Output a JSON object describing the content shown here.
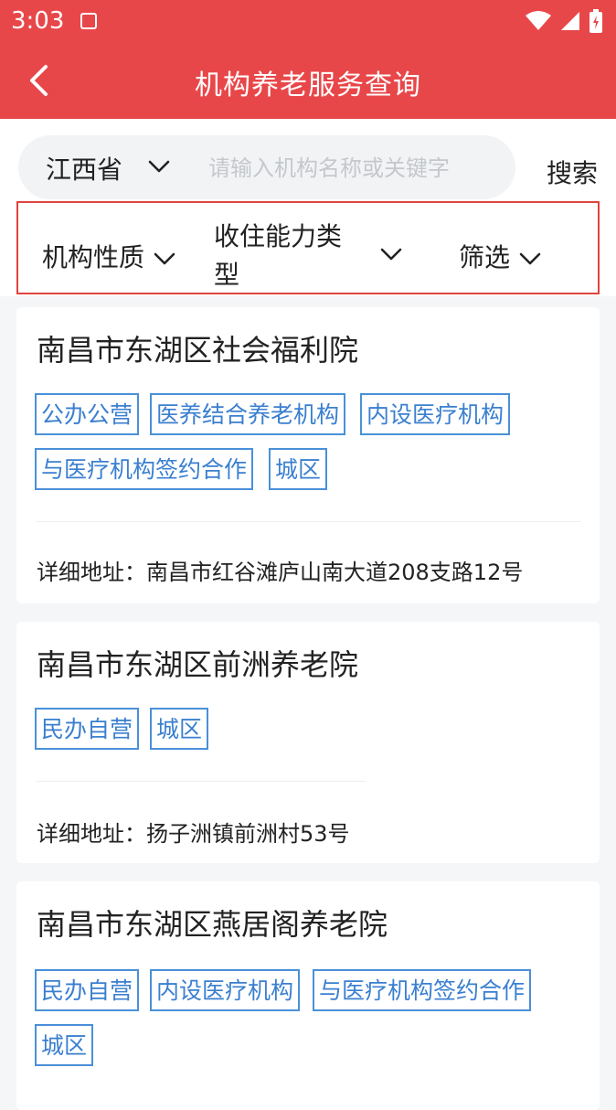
{
  "status": {
    "time": "3:03"
  },
  "nav": {
    "title": "机构养老服务查询"
  },
  "search": {
    "province": "江西省",
    "placeholder": "请输入机构名称或关键字",
    "button": "搜索"
  },
  "filters": {
    "nature": "机构性质",
    "capacity": "收住能力类型",
    "screen": "筛选"
  },
  "address_label": "详细地址：",
  "institutions": [
    {
      "name": "南昌市东湖区社会福利院",
      "tags": [
        "公办公营",
        "医养结合养老机构",
        "内设医疗机构",
        "与医疗机构签约合作",
        "城区"
      ],
      "address": "南昌市红谷滩庐山南大道208支路12号"
    },
    {
      "name": "南昌市东湖区前洲养老院",
      "tags": [
        "民办自营",
        "城区"
      ],
      "address": "扬子洲镇前洲村53号"
    },
    {
      "name": "南昌市东湖区燕居阁养老院",
      "tags": [
        "民办自营",
        "内设医疗机构",
        "与医疗机构签约合作",
        "城区"
      ],
      "address": ""
    }
  ]
}
